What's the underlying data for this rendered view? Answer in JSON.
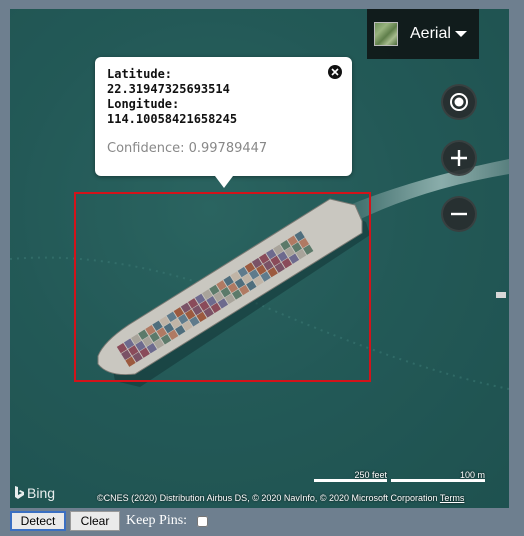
{
  "map_type": {
    "label": "Aerial",
    "thumbnail": "aerial-thumbnail",
    "caret_icon": "chevron-down-icon"
  },
  "controls": {
    "locate_icon": "locate-me-icon",
    "zoom_in_icon": "plus-icon",
    "zoom_out_icon": "minus-icon"
  },
  "infobox": {
    "latitude_label": "Latitude:",
    "latitude_value": "22.31947325693514",
    "longitude_label": "Longitude:",
    "longitude_value": "114.10058421658245",
    "confidence_text": "Confidence: 0.99789447",
    "close_icon": "close-icon"
  },
  "detection": {
    "color": "#d3131a"
  },
  "map_footer": {
    "logo": "Bing",
    "copyright": "©CNES (2020) Distribution Airbus DS, © 2020 NavInfo, © 2020 Microsoft Corporation",
    "terms": "Terms",
    "scale_feet": "250 feet",
    "scale_meters": "100 m"
  },
  "toolbar": {
    "detect_label": "Detect",
    "clear_label": "Clear",
    "keep_pins_label": "Keep Pins:",
    "keep_pins_checked": false
  }
}
